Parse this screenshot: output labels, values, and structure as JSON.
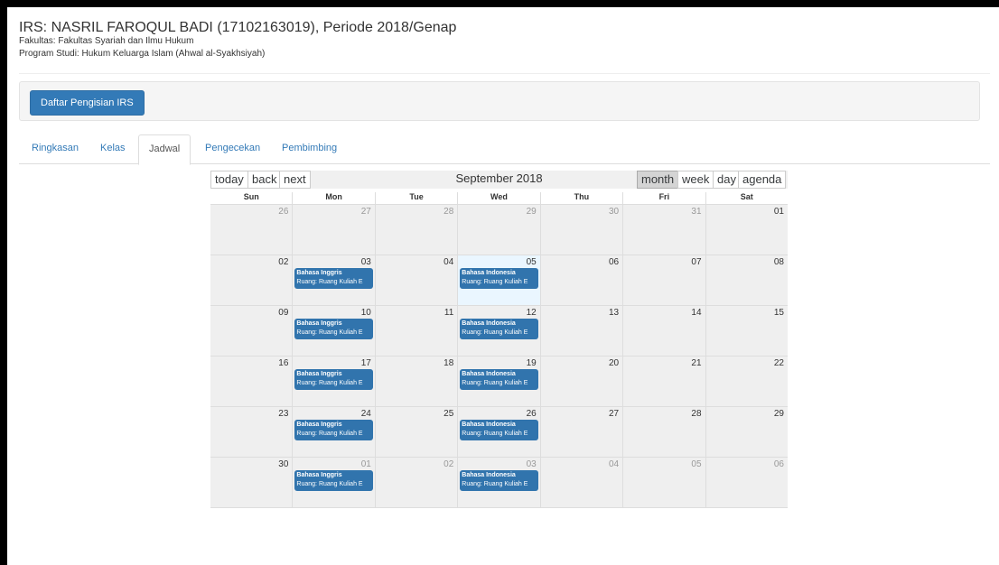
{
  "header": {
    "title": "IRS: NASRIL FAROQUL BADI (17102163019), Periode 2018/Genap",
    "fakultas": "Fakultas: Fakultas Syariah dan Ilmu Hukum",
    "prodi": "Program Studi: Hukum Keluarga Islam (Ahwal al-Syakhsiyah)"
  },
  "actions": {
    "daftar_label": "Daftar Pengisian IRS"
  },
  "tabs": [
    {
      "label": "Ringkasan"
    },
    {
      "label": "Kelas"
    },
    {
      "label": "Jadwal"
    },
    {
      "label": "Pengecekan"
    },
    {
      "label": "Pembimbing"
    }
  ],
  "calendar": {
    "toolbar": {
      "today": "today",
      "back": "back",
      "next": "next",
      "label": "September 2018",
      "month": "month",
      "week": "week",
      "day": "day",
      "agenda": "agenda"
    },
    "weekdays": [
      "Sun",
      "Mon",
      "Tue",
      "Wed",
      "Thu",
      "Fri",
      "Sat"
    ],
    "weeks": [
      [
        "26",
        "27",
        "28",
        "29",
        "30",
        "31",
        "01"
      ],
      [
        "02",
        "03",
        "04",
        "05",
        "06",
        "07",
        "08"
      ],
      [
        "09",
        "10",
        "11",
        "12",
        "13",
        "14",
        "15"
      ],
      [
        "16",
        "17",
        "18",
        "19",
        "20",
        "21",
        "22"
      ],
      [
        "23",
        "24",
        "25",
        "26",
        "27",
        "28",
        "29"
      ],
      [
        "30",
        "01",
        "02",
        "03",
        "04",
        "05",
        "06"
      ]
    ],
    "events": {
      "mon": {
        "title": "Bahasa Inggris",
        "room": "Ruang: Ruang Kuliah E"
      },
      "wed": {
        "title": "Bahasa Indonesia",
        "room": "Ruang: Ruang Kuliah E"
      }
    }
  }
}
